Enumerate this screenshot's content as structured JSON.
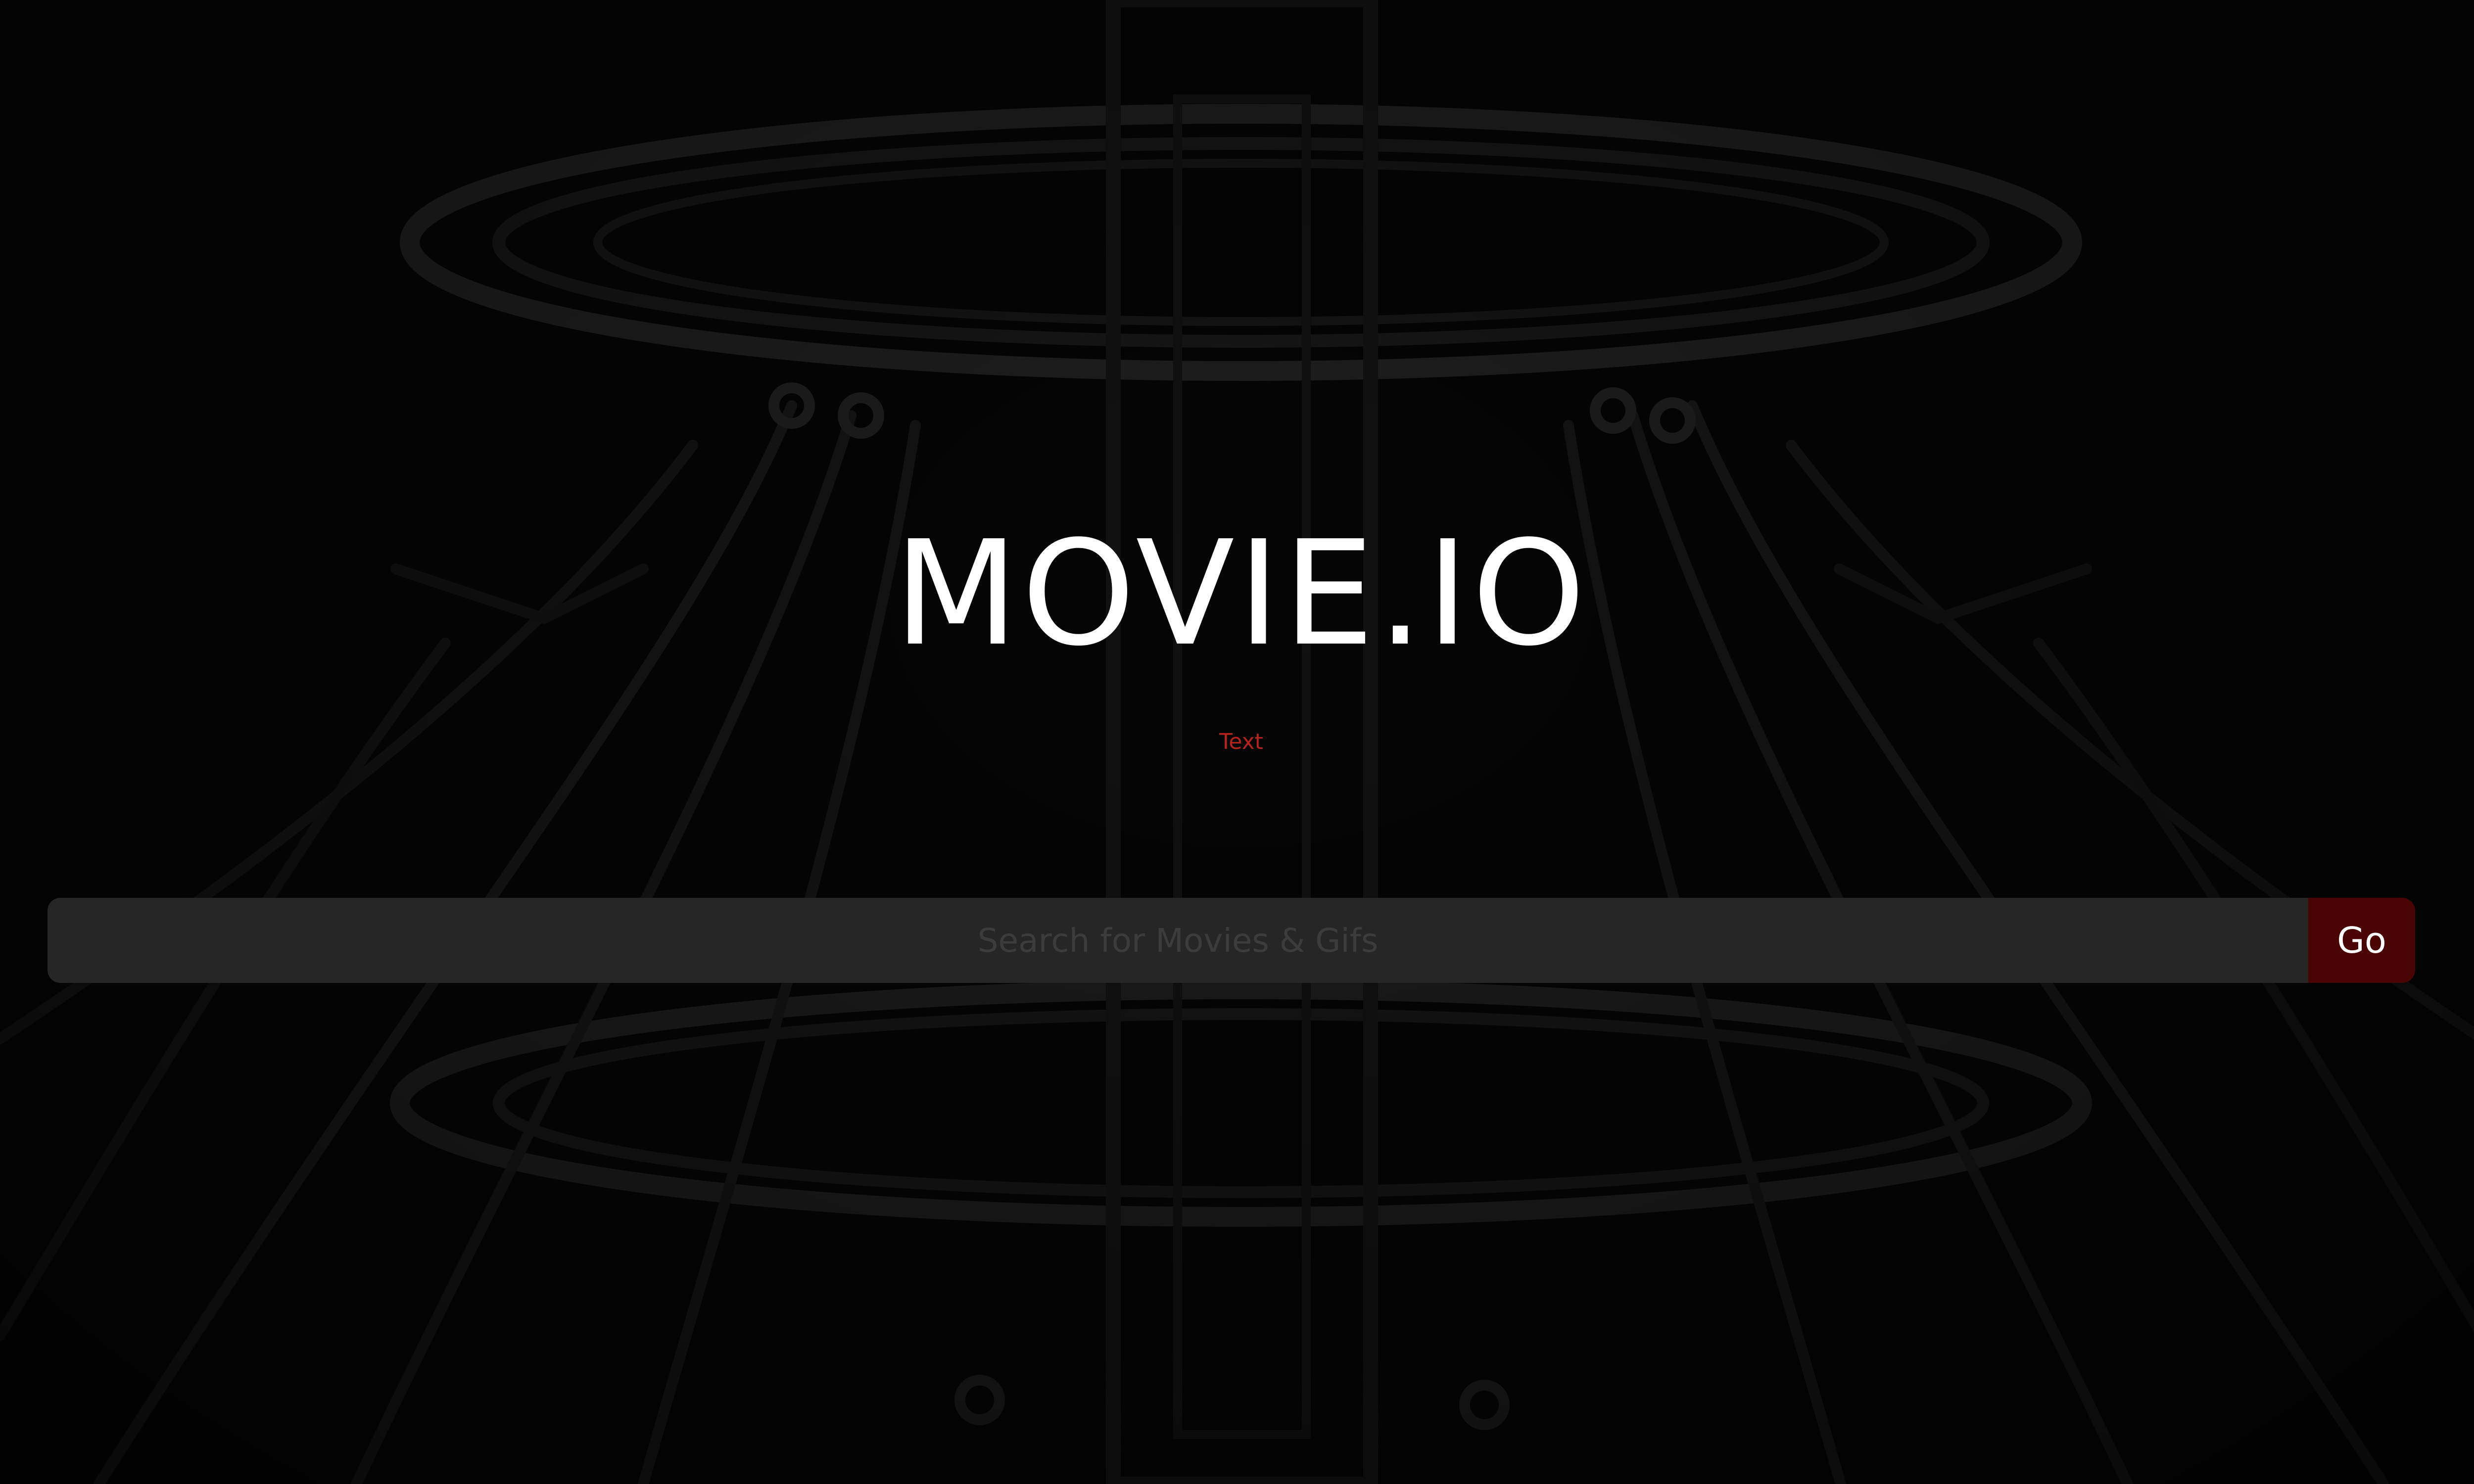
{
  "app": {
    "title": "MOVIE.IO",
    "subtitle": "Text"
  },
  "search": {
    "placeholder": "Search for Movies & Gifs",
    "value": "",
    "button_label": "Go"
  },
  "background": {
    "icon": "sci-fi-machinery-artwork"
  },
  "colors": {
    "background": "#050505",
    "title": "#ffffff",
    "subtitle": "#b5241c",
    "search_field": "#262626",
    "go_button": "#4a0404"
  }
}
